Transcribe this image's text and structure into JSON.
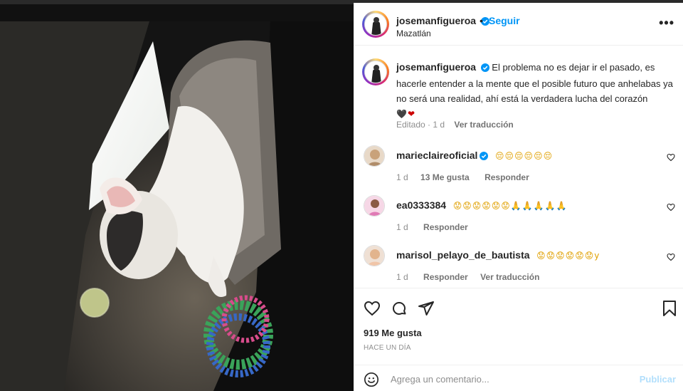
{
  "post": {
    "author": "josemanfigueroa",
    "follow_label": "Seguir",
    "location": "Mazatlán",
    "separator": "•",
    "more_label": "•••"
  },
  "caption": {
    "author": "josemanfigueroa",
    "text": "El problema no es dejar ir el pasado, es hacerle entender a la mente que el posible futuro que anhelabas ya no será una realidad, ahí está la verdadera lucha del corazón",
    "emojis": "🖤❤",
    "edited": "Editado · 1 d",
    "translate_label": "Ver traducción"
  },
  "comments": [
    {
      "author": "marieclaireoficial",
      "text": "😔😔😔😔😔😔",
      "verified": true,
      "age": "1 d",
      "likes": "13 Me gusta",
      "reply_label": "Responder",
      "translate_label": ""
    },
    {
      "author": "ea0333384",
      "text": "😟😟😟😟😟😟🙏🙏🙏🙏🙏",
      "verified": false,
      "age": "1 d",
      "likes": "",
      "reply_label": "Responder",
      "translate_label": ""
    },
    {
      "author": "marisol_pelayo_de_bautista",
      "text": "😟😟😟😟😟😟y",
      "verified": false,
      "age": "1 d",
      "likes": "",
      "reply_label": "Responder",
      "translate_label": "Ver traducción"
    }
  ],
  "footer": {
    "likes": "919 Me gusta",
    "time": "HACE UN DÍA",
    "comment_placeholder": "Agrega un comentario...",
    "publish_label": "Publicar"
  },
  "colors": {
    "accent": "#0095f6",
    "publish_disabled": "#b2dffc",
    "heart_red": "#ed4956"
  }
}
